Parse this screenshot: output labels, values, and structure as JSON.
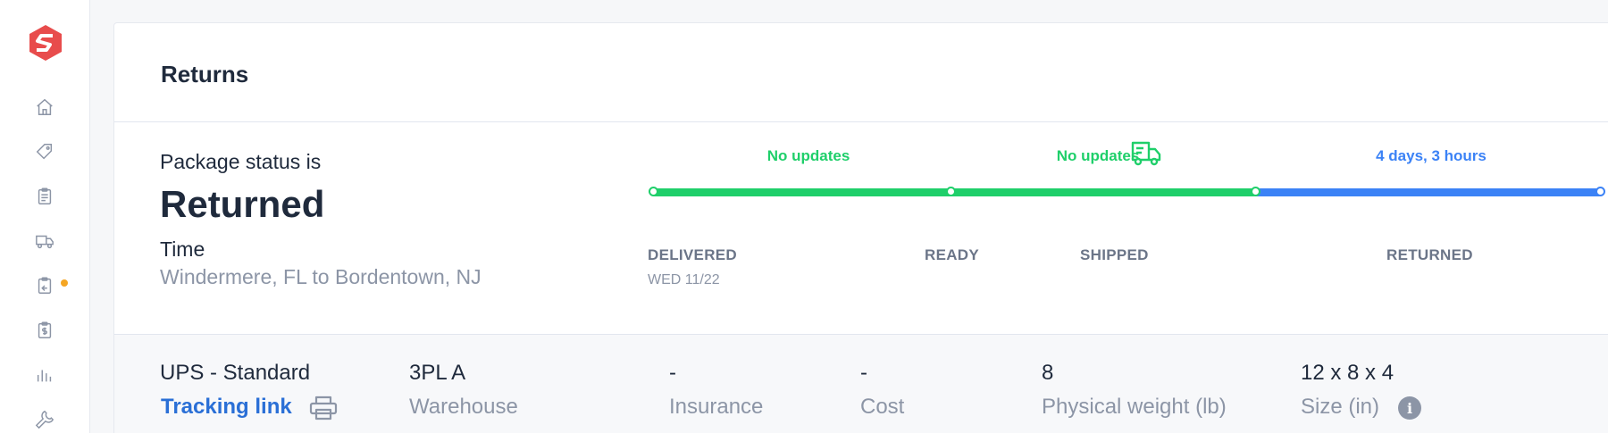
{
  "sidebar": {
    "icons": [
      "home-icon",
      "tag-icon",
      "clipboard-icon",
      "truck-icon",
      "returns-icon",
      "billing-icon",
      "chart-icon",
      "wrench-icon"
    ]
  },
  "header": {
    "title": "Returns"
  },
  "status": {
    "label": "Package status is",
    "value": "Returned",
    "time_label": "Time",
    "route": "Windermere, FL to Bordentown, NJ"
  },
  "timeline": {
    "updates": [
      "No updates",
      "No updates",
      "4 days, 3 hours"
    ],
    "stages": [
      "DELIVERED",
      "READY",
      "SHIPPED",
      "RETURNED"
    ],
    "delivered_date": "WED 11/22",
    "colors": {
      "done": "#1fcf6a",
      "active": "#3b82f6"
    }
  },
  "details": {
    "carrier": "UPS - Standard",
    "tracking_link": "Tracking link",
    "warehouse": {
      "value": "3PL A",
      "label": "Warehouse"
    },
    "insurance": {
      "value": "-",
      "label": "Insurance"
    },
    "cost": {
      "value": "-",
      "label": "Cost"
    },
    "weight": {
      "value": "8",
      "label": "Physical weight (lb)"
    },
    "size": {
      "value": "12 x 8 x 4",
      "label": "Size (in)"
    },
    "info_icon": "i"
  }
}
